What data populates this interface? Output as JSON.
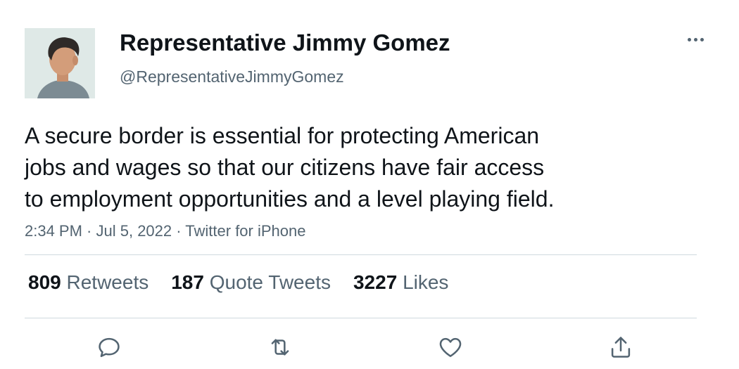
{
  "author": {
    "display_name": "Representative Jimmy Gomez",
    "handle": "@RepresentativeJimmyGomez"
  },
  "tweet": {
    "lines": [
      "A secure border is essential for protecting American",
      "jobs and wages so that our citizens have fair access",
      "to employment opportunities and a level playing field."
    ],
    "time": "2:34 PM",
    "date": "Jul 5, 2022",
    "source": "Twitter for iPhone",
    "separator": " · "
  },
  "stats": {
    "retweets_count": "809",
    "retweets_label": "Retweets",
    "quotes_count": "187",
    "quotes_label": "Quote Tweets",
    "likes_count": "3227",
    "likes_label": "Likes"
  },
  "icons": {
    "more": "more-horizontal-icon",
    "reply": "reply-icon",
    "retweet": "retweet-icon",
    "like": "heart-icon",
    "share": "share-icon"
  },
  "colors": {
    "text": "#0f1419",
    "secondary": "#536471",
    "divider": "#cfd9de"
  }
}
